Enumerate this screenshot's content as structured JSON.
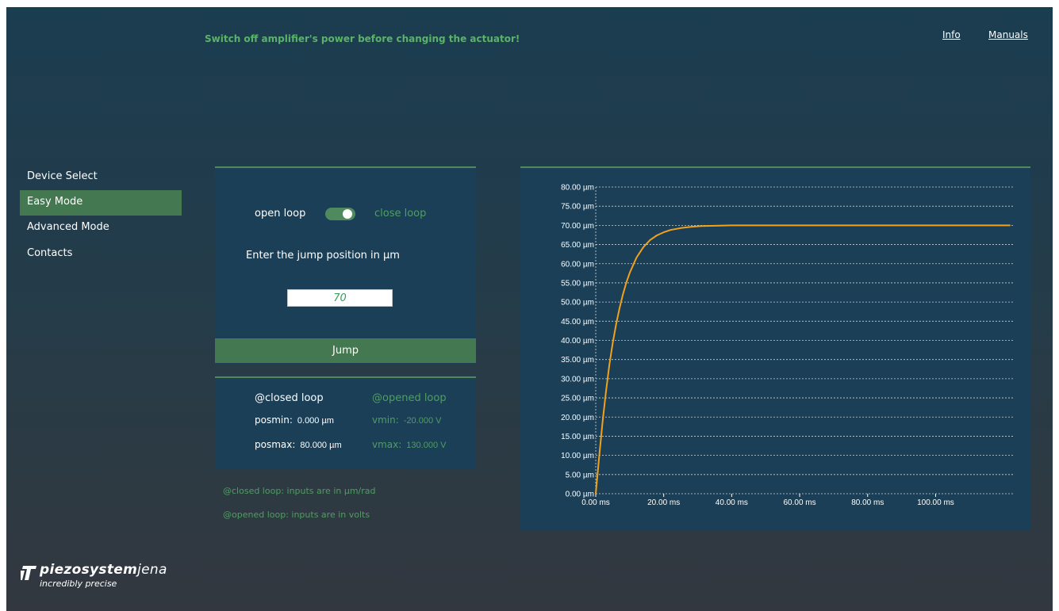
{
  "header": {
    "warning": "Switch off amplifier's power before changing the actuator!",
    "links": {
      "info": "Info",
      "manuals": "Manuals"
    }
  },
  "sidebar": {
    "items": [
      {
        "label": "Device Select",
        "active": false
      },
      {
        "label": "Easy Mode",
        "active": true
      },
      {
        "label": "Advanced Mode",
        "active": false
      },
      {
        "label": "Contacts",
        "active": false
      }
    ]
  },
  "control": {
    "open_loop_label": "open loop",
    "close_loop_label": "close loop",
    "toggle_state": "close loop",
    "prompt": "Enter the jump position in µm",
    "input_value": "70",
    "jump_label": "Jump"
  },
  "limits": {
    "closed_header": "@closed loop",
    "opened_header": "@opened loop",
    "posmin_label": "posmin:",
    "posmin_value": "0.000 µm",
    "posmax_label": "posmax:",
    "posmax_value": "80.000 µm",
    "vmin_label": "vmin:",
    "vmin_value": "-20.000 V",
    "vmax_label": "vmax:",
    "vmax_value": "130.000 V"
  },
  "notes": {
    "closed": "@closed loop:  inputs are in µm/rad",
    "opened": "@opened loop:  inputs are in volts"
  },
  "logo": {
    "name_bold": "piezosystem",
    "name_light": "jena",
    "tagline": "incredibly precise"
  },
  "colors": {
    "accent_green": "#447851",
    "text_green": "#4f9e62",
    "panel": "#1b3f56",
    "curve": "#f0a21c"
  },
  "chart_data": {
    "type": "line",
    "title": "",
    "xlabel": "",
    "ylabel": "",
    "xlim": [
      0,
      123
    ],
    "ylim": [
      0,
      80
    ],
    "grid": true,
    "x_ticks": [
      "0.00 ms",
      "20.00 ms",
      "40.00 ms",
      "60.00 ms",
      "80.00 ms",
      "100.00 ms"
    ],
    "x_tick_values": [
      0,
      20,
      40,
      60,
      80,
      100
    ],
    "y_ticks": [
      "0.00 µm",
      "5.00 µm",
      "10.00 µm",
      "15.00 µm",
      "20.00 µm",
      "25.00 µm",
      "30.00 µm",
      "35.00 µm",
      "40.00 µm",
      "45.00 µm",
      "50.00 µm",
      "55.00 µm",
      "60.00 µm",
      "65.00 µm",
      "70.00 µm",
      "75.00 µm",
      "80.00 µm"
    ],
    "y_tick_values": [
      0,
      5,
      10,
      15,
      20,
      25,
      30,
      35,
      40,
      45,
      50,
      55,
      60,
      65,
      70,
      75,
      80
    ],
    "series": [
      {
        "color": "#f0a21c",
        "x": [
          0,
          1,
          2,
          3,
          4,
          5,
          6,
          7,
          8,
          9,
          10,
          12,
          14,
          16,
          18,
          20,
          22,
          25,
          28,
          31,
          35,
          40,
          50,
          60,
          70,
          80,
          90,
          100,
          110,
          122
        ],
        "y": [
          0,
          9.6,
          18.7,
          26.6,
          33.5,
          39.3,
          44.2,
          48.4,
          52.0,
          55.1,
          57.6,
          61.6,
          64.3,
          66.2,
          67.4,
          68.2,
          68.8,
          69.3,
          69.6,
          69.8,
          69.9,
          70.0,
          70.0,
          70.0,
          70.0,
          70.0,
          70.0,
          70.0,
          70.0,
          70.0
        ]
      }
    ]
  }
}
